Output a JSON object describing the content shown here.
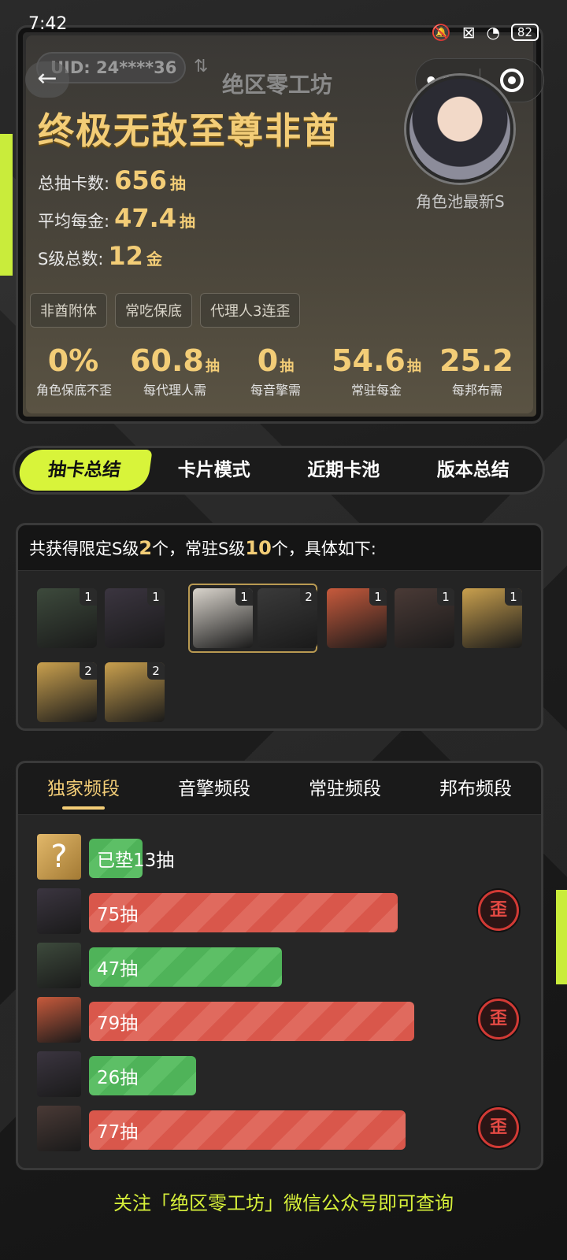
{
  "status_bar": {
    "time": "7:42",
    "battery": "82"
  },
  "header": {
    "uid": "UID: 24****36",
    "app_title": "绝区零工坊",
    "main_title": "终极无敌至尊非酋",
    "avatar_caption": "角色池最新S",
    "stats": [
      {
        "label": "总抽卡数:",
        "value": "656",
        "unit": "抽"
      },
      {
        "label": "平均每金:",
        "value": "47.4",
        "unit": "抽"
      },
      {
        "label": "S级总数:",
        "value": "12",
        "unit": "金"
      }
    ],
    "tags": [
      "非酋附体",
      "常吃保底",
      "代理人3连歪"
    ],
    "metrics": [
      {
        "value": "0%",
        "unit": "",
        "label": "角色保底不歪"
      },
      {
        "value": "60.8",
        "unit": "抽",
        "label": "每代理人需"
      },
      {
        "value": "0",
        "unit": "抽",
        "label": "每音擎需"
      },
      {
        "value": "54.6",
        "unit": "抽",
        "label": "常驻每金"
      },
      {
        "value": "25.2",
        "unit": "",
        "label": "每邦布需"
      }
    ]
  },
  "main_tabs": [
    "抽卡总结",
    "卡片模式",
    "近期卡池",
    "版本总结"
  ],
  "summary": {
    "prefix": "共获得限定S级",
    "limited": "2",
    "middle": "个，常驻S级",
    "standard": "10",
    "suffix": "个，具体如下:",
    "characters": [
      {
        "count": "1",
        "color": "#3d4a3c"
      },
      {
        "count": "1",
        "color": "#3b3540"
      },
      {
        "count": "1",
        "color": "#d9d4cc"
      },
      {
        "count": "2",
        "color": "#3a3a3a"
      },
      {
        "count": "1",
        "color": "#c75a3c"
      },
      {
        "count": "1",
        "color": "#4a3a36"
      },
      {
        "count": "1",
        "color": "#c9a04e"
      },
      {
        "count": "2",
        "color": "#c9a04e"
      },
      {
        "count": "2",
        "color": "#c9a04e"
      }
    ]
  },
  "stage": {
    "tabs": [
      "独家频段",
      "音擎频段",
      "常驻频段",
      "邦布频段"
    ],
    "rows": [
      {
        "label": "已垫13抽",
        "pulls": 13,
        "color": "green",
        "lost": false,
        "pending": true
      },
      {
        "label": "75抽",
        "pulls": 75,
        "color": "red",
        "lost": true
      },
      {
        "label": "47抽",
        "pulls": 47,
        "color": "green",
        "lost": false
      },
      {
        "label": "79抽",
        "pulls": 79,
        "color": "red",
        "lost": true
      },
      {
        "label": "26抽",
        "pulls": 26,
        "color": "green",
        "lost": false
      },
      {
        "label": "77抽",
        "pulls": 77,
        "color": "red",
        "lost": true
      }
    ],
    "lost_badge": "歪"
  },
  "footer_note": "关注「绝区零工坊」微信公众号即可查询"
}
